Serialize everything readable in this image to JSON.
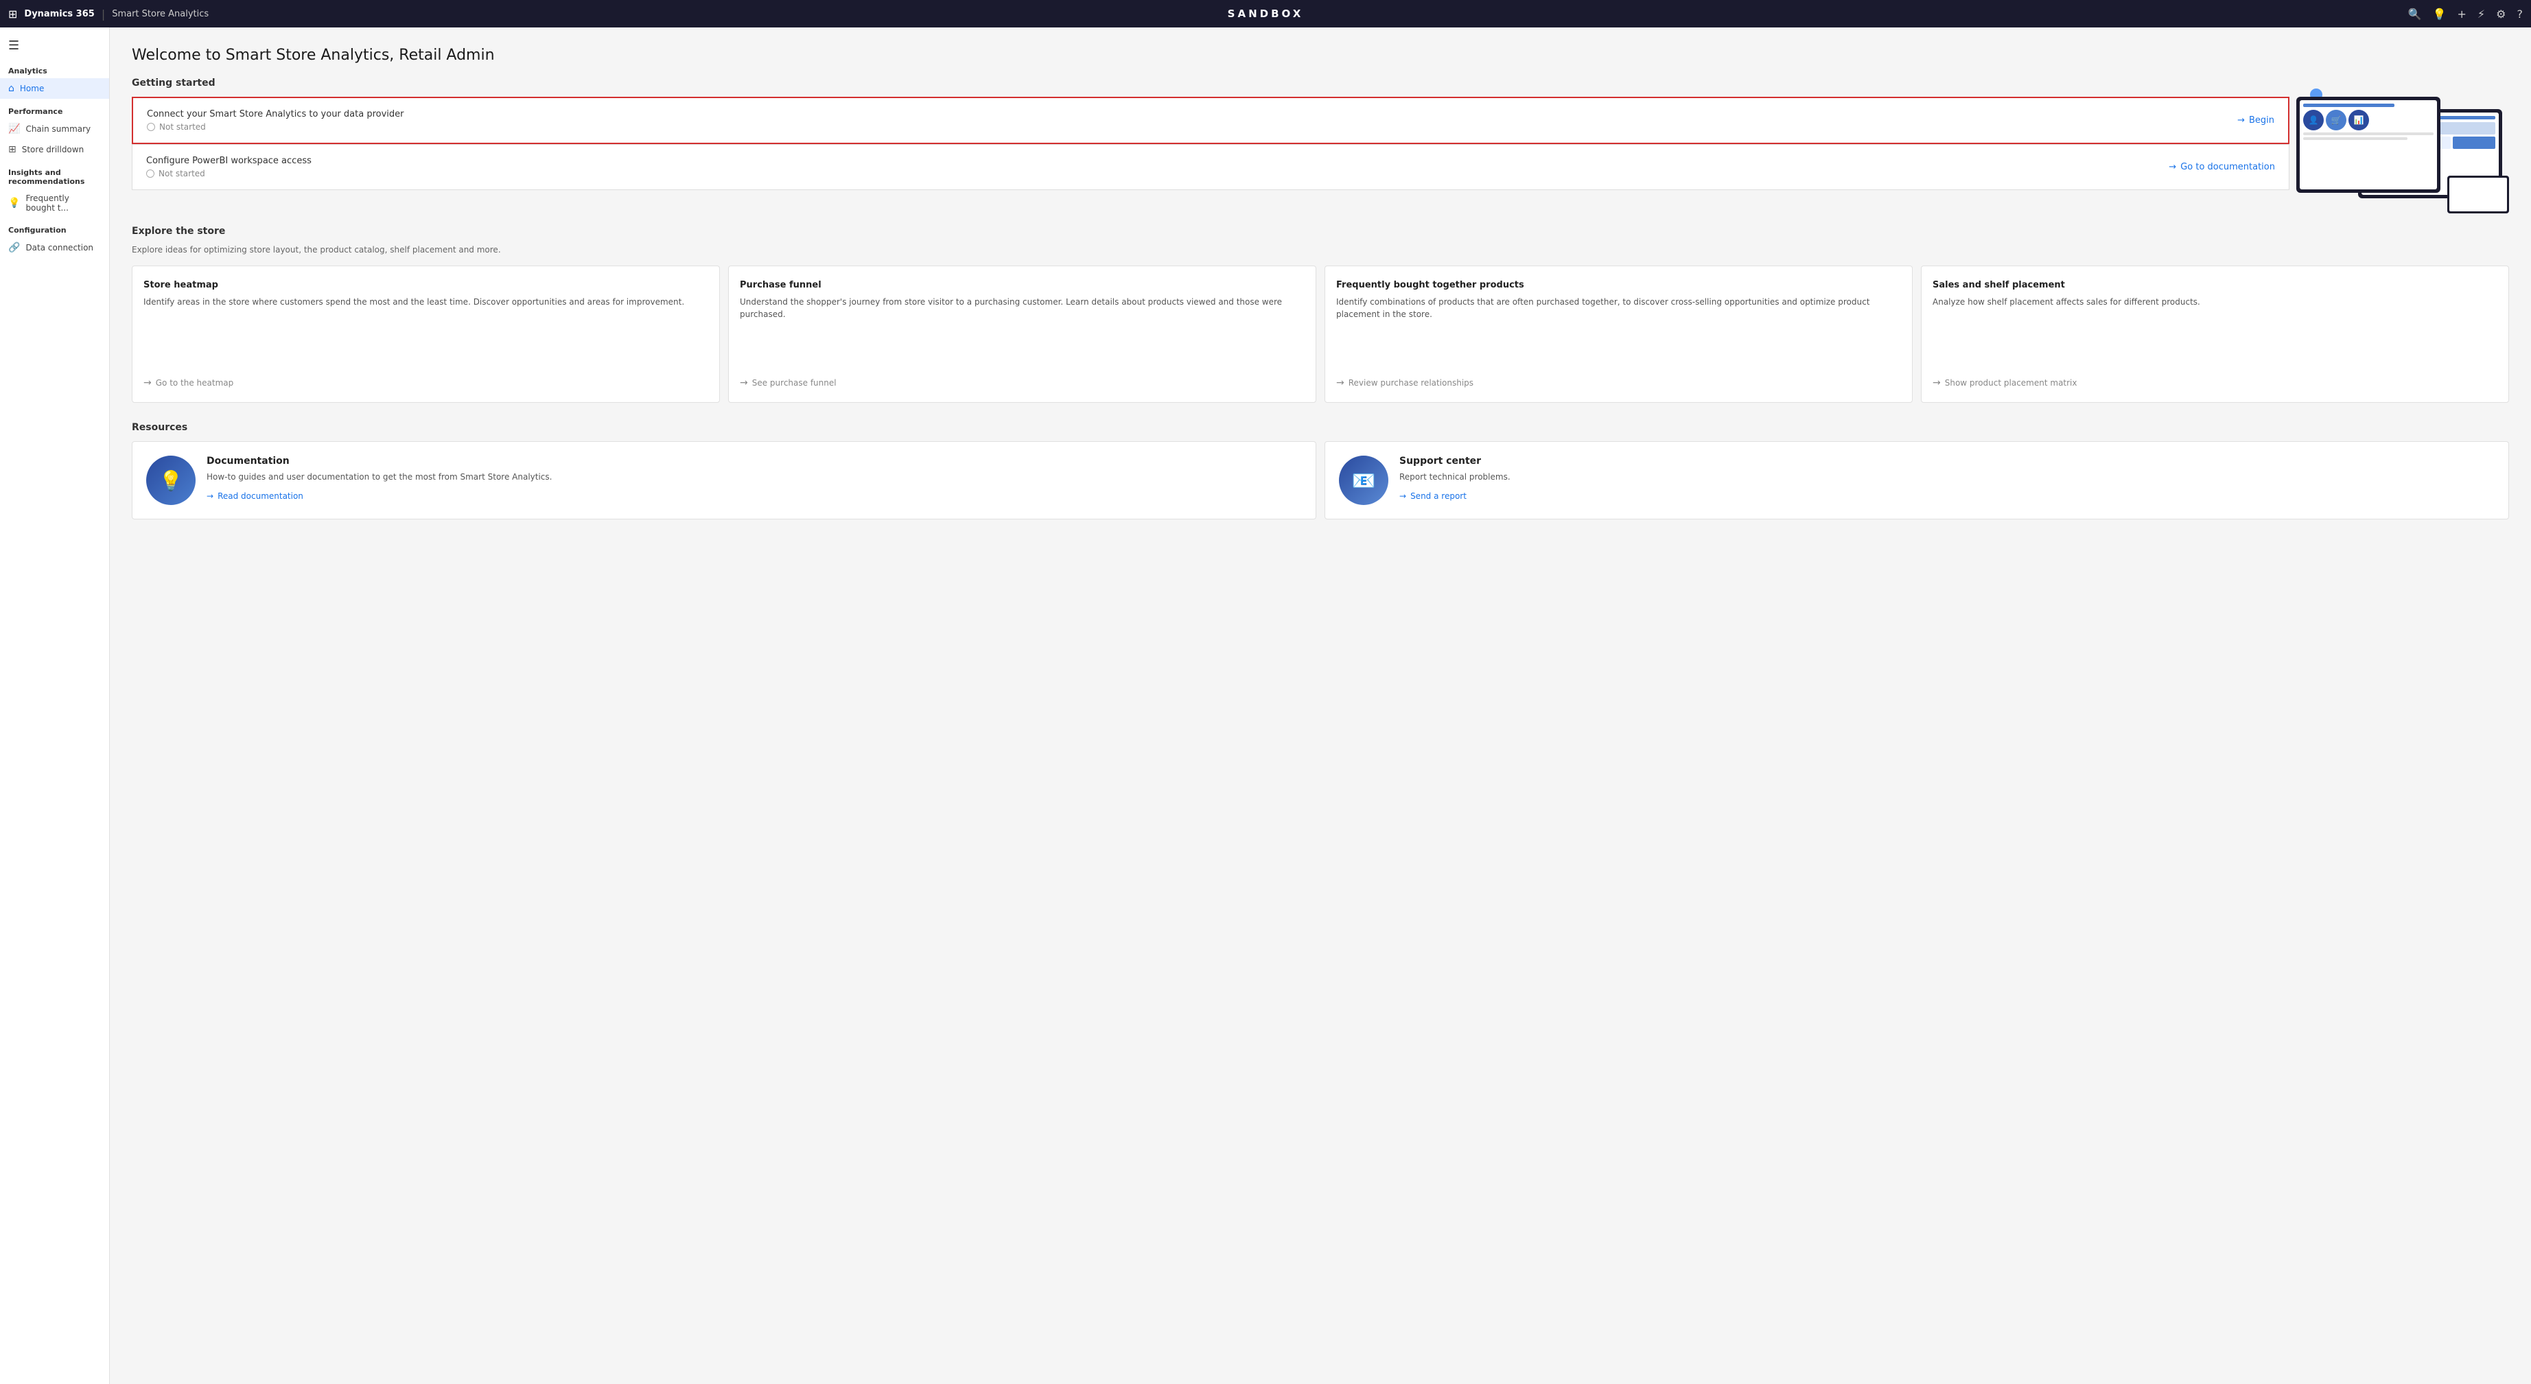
{
  "topNav": {
    "appsIcon": "⊞",
    "brand": "Dynamics 365",
    "separator": "|",
    "pageName": "Smart Store Analytics",
    "sandboxLabel": "SANDBOX",
    "searchIcon": "🔍",
    "helpIcon": "💡",
    "addIcon": "+",
    "filterIcon": "⚡",
    "settingsIcon": "⚙",
    "questionIcon": "?"
  },
  "sidebar": {
    "hamburgerIcon": "☰",
    "sections": [
      {
        "label": "Analytics",
        "items": [
          {
            "id": "home",
            "icon": "⌂",
            "label": "Home",
            "active": true
          }
        ]
      },
      {
        "label": "Performance",
        "items": [
          {
            "id": "chain-summary",
            "icon": "📈",
            "label": "Chain summary",
            "active": false
          },
          {
            "id": "store-drilldown",
            "icon": "⊞",
            "label": "Store drilldown",
            "active": false
          }
        ]
      },
      {
        "label": "Insights and recommendations",
        "items": [
          {
            "id": "frequently-bought",
            "icon": "💡",
            "label": "Frequently bought t...",
            "active": false
          }
        ]
      },
      {
        "label": "Configuration",
        "items": [
          {
            "id": "data-connection",
            "icon": "🔗",
            "label": "Data connection",
            "active": false
          }
        ]
      }
    ]
  },
  "page": {
    "title": "Welcome to Smart Store Analytics, Retail Admin",
    "gettingStarted": {
      "sectionLabel": "Getting started",
      "cards": [
        {
          "id": "connect-provider",
          "title": "Connect your Smart Store Analytics to your data provider",
          "status": "Not started",
          "actionLabel": "Begin",
          "highlighted": true
        },
        {
          "id": "configure-powerbi",
          "title": "Configure PowerBI workspace access",
          "status": "Not started",
          "actionLabel": "Go to documentation",
          "highlighted": false
        }
      ]
    },
    "exploreStore": {
      "sectionLabel": "Explore the store",
      "subtitle": "Explore ideas for optimizing store layout, the product catalog, shelf placement and more.",
      "cards": [
        {
          "id": "store-heatmap",
          "title": "Store heatmap",
          "description": "Identify areas in the store where customers spend the most and the least time. Discover opportunities and areas for improvement.",
          "linkLabel": "Go to the heatmap"
        },
        {
          "id": "purchase-funnel",
          "title": "Purchase funnel",
          "description": "Understand the shopper's journey from store visitor to a purchasing customer. Learn details about products viewed and those were purchased.",
          "linkLabel": "See purchase funnel"
        },
        {
          "id": "frequently-bought",
          "title": "Frequently bought together products",
          "description": "Identify combinations of products that are often purchased together, to discover cross-selling opportunities and optimize product placement in the store.",
          "linkLabel": "Review purchase relationships"
        },
        {
          "id": "sales-shelf",
          "title": "Sales and shelf placement",
          "description": "Analyze how shelf placement affects sales for different products.",
          "linkLabel": "Show product placement matrix"
        }
      ]
    },
    "resources": {
      "sectionLabel": "Resources",
      "cards": [
        {
          "id": "documentation",
          "title": "Documentation",
          "description": "How-to guides and user documentation to get the most from Smart Store Analytics.",
          "linkLabel": "Read documentation",
          "iconEmoji": "💡"
        },
        {
          "id": "support-center",
          "title": "Support center",
          "description": "Report technical problems.",
          "linkLabel": "Send a report",
          "iconEmoji": "📧"
        }
      ]
    }
  }
}
